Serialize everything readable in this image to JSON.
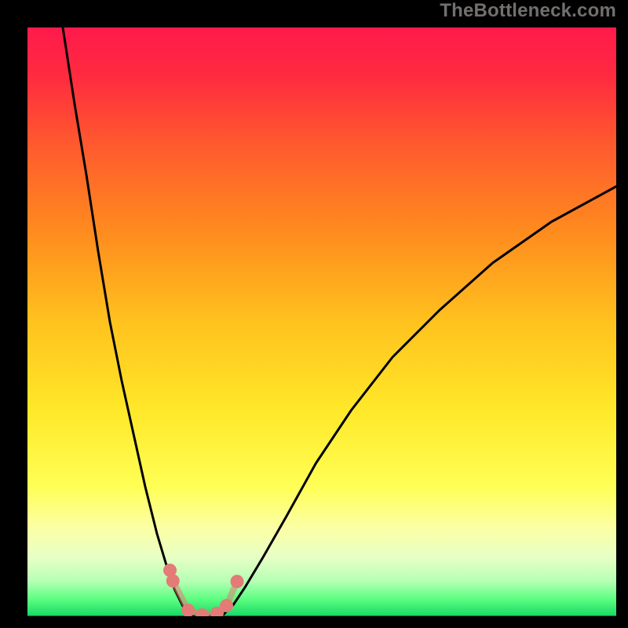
{
  "watermark": "TheBottleneck.com",
  "chart_data": {
    "type": "line",
    "title": "",
    "xlabel": "",
    "ylabel": "",
    "xlim": [
      0,
      100
    ],
    "ylim": [
      0,
      100
    ],
    "gradient_stops": [
      {
        "offset": 0.0,
        "color": "#ff1a4b"
      },
      {
        "offset": 0.08,
        "color": "#ff2a40"
      },
      {
        "offset": 0.2,
        "color": "#ff5a2e"
      },
      {
        "offset": 0.35,
        "color": "#ff8c1e"
      },
      {
        "offset": 0.5,
        "color": "#ffc21e"
      },
      {
        "offset": 0.65,
        "color": "#ffe829"
      },
      {
        "offset": 0.78,
        "color": "#ffff55"
      },
      {
        "offset": 0.85,
        "color": "#fbffa5"
      },
      {
        "offset": 0.9,
        "color": "#e7ffc5"
      },
      {
        "offset": 0.94,
        "color": "#b7ffb5"
      },
      {
        "offset": 0.97,
        "color": "#5eff82"
      },
      {
        "offset": 1.0,
        "color": "#16d865"
      }
    ],
    "series": [
      {
        "name": "curve-left",
        "comment": "steep descending branch from top-left into the dip",
        "x": [
          6,
          8,
          10,
          12,
          14,
          16,
          18,
          20,
          22,
          23.5,
          25,
          26.5,
          28
        ],
        "y": [
          100,
          87,
          75,
          62,
          50,
          40,
          31,
          22,
          14,
          9,
          4.5,
          1.5,
          0
        ]
      },
      {
        "name": "curve-right",
        "comment": "shallow ascending branch from the dip toward upper-right",
        "x": [
          33,
          35,
          37,
          40,
          44,
          49,
          55,
          62,
          70,
          79,
          89,
          100
        ],
        "y": [
          0,
          2,
          5,
          10,
          17,
          26,
          35,
          44,
          52,
          60,
          67,
          73
        ]
      }
    ],
    "floor_line": {
      "y": 0
    },
    "markers": {
      "comment": "salmon/pink dots + short segments near the dip bottom",
      "color": "#e37b76",
      "points": [
        {
          "x": 24.2,
          "y": 7.8
        },
        {
          "x": 24.7,
          "y": 6.0
        },
        {
          "x": 27.3,
          "y": 1.0
        },
        {
          "x": 29.7,
          "y": 0.2
        },
        {
          "x": 32.2,
          "y": 0.5
        },
        {
          "x": 33.8,
          "y": 1.8
        },
        {
          "x": 35.6,
          "y": 5.9
        }
      ]
    },
    "dip_center_x": 30
  }
}
